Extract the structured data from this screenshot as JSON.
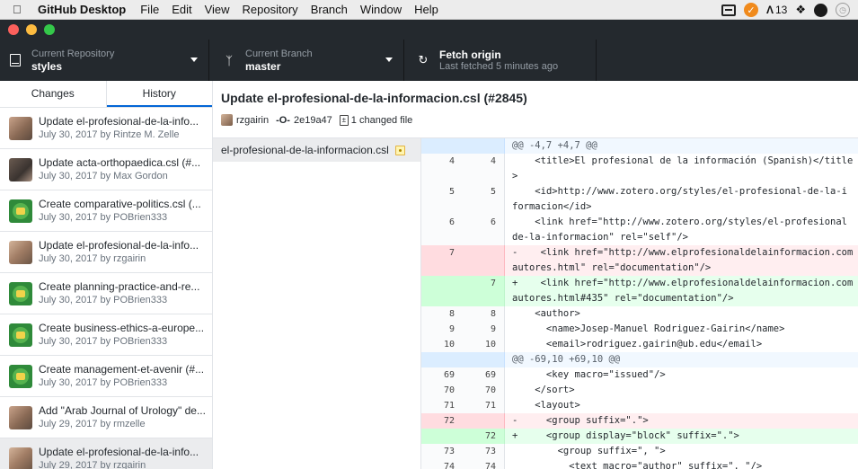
{
  "menubar": {
    "app": "GitHub Desktop",
    "items": [
      "File",
      "Edit",
      "View",
      "Repository",
      "Branch",
      "Window",
      "Help"
    ],
    "tray_adobe": "13"
  },
  "toolbar": {
    "repo_label": "Current Repository",
    "repo_value": "styles",
    "branch_label": "Current Branch",
    "branch_value": "master",
    "fetch_label": "Fetch origin",
    "fetch_status": "Last fetched 5 minutes ago"
  },
  "sidebar": {
    "tabs": [
      "Changes",
      "History"
    ],
    "commits": [
      {
        "title": "Update el-profesional-de-la-info...",
        "meta": "July 30, 2017 by Rintze M. Zelle"
      },
      {
        "title": "Update acta-orthopaedica.csl (#...",
        "meta": "July 30, 2017 by Max Gordon"
      },
      {
        "title": "Create comparative-politics.csl (...",
        "meta": "July 30, 2017 by POBrien333"
      },
      {
        "title": "Update el-profesional-de-la-info...",
        "meta": "July 30, 2017 by rzgairin"
      },
      {
        "title": "Create planning-practice-and-re...",
        "meta": "July 30, 2017 by POBrien333"
      },
      {
        "title": "Create business-ethics-a-europe...",
        "meta": "July 30, 2017 by POBrien333"
      },
      {
        "title": "Create management-et-avenir (#...",
        "meta": "July 30, 2017 by POBrien333"
      },
      {
        "title": "Add \"Arab Journal of Urology\" de...",
        "meta": "July 29, 2017 by rmzelle"
      },
      {
        "title": "Update el-profesional-de-la-info...",
        "meta": "July 29, 2017 by rzgairin"
      }
    ]
  },
  "commit": {
    "title": "Update el-profesional-de-la-informacion.csl (#2845)",
    "author": "rzgairin",
    "sha": "2e19a47",
    "files_changed": "1 changed file",
    "file": "el-profesional-de-la-informacion.csl"
  },
  "diff": [
    {
      "type": "hunk",
      "old": "",
      "new": "",
      "text": "@@ -4,7 +4,7 @@"
    },
    {
      "type": "ctx",
      "old": "4",
      "new": "4",
      "text": "    <title>El profesional de la información (Spanish)</title\n>"
    },
    {
      "type": "ctx",
      "old": "5",
      "new": "5",
      "text": "    <id>http://www.zotero.org/styles/el-profesional-de-la-i\nformacion</id>"
    },
    {
      "type": "ctx",
      "old": "6",
      "new": "6",
      "text": "    <link href=\"http://www.zotero.org/styles/el-profesional\nde-la-informacion\" rel=\"self\"/>"
    },
    {
      "type": "del",
      "old": "7",
      "new": "",
      "text": "-    <link href=\"http://www.elprofesionaldelainformacion.com\nautores.html\" rel=\"documentation\"/>"
    },
    {
      "type": "add",
      "old": "",
      "new": "7",
      "text": "+    <link href=\"http://www.elprofesionaldelainformacion.com\nautores.html#435\" rel=\"documentation\"/>"
    },
    {
      "type": "ctx",
      "old": "8",
      "new": "8",
      "text": "    <author>"
    },
    {
      "type": "ctx",
      "old": "9",
      "new": "9",
      "text": "      <name>Josep-Manuel Rodriguez-Gairin</name>"
    },
    {
      "type": "ctx",
      "old": "10",
      "new": "10",
      "text": "      <email>rodriguez.gairin@ub.edu</email>"
    },
    {
      "type": "hunk",
      "old": "",
      "new": "",
      "text": "@@ -69,10 +69,10 @@"
    },
    {
      "type": "ctx",
      "old": "69",
      "new": "69",
      "text": "      <key macro=\"issued\"/>"
    },
    {
      "type": "ctx",
      "old": "70",
      "new": "70",
      "text": "    </sort>"
    },
    {
      "type": "ctx",
      "old": "71",
      "new": "71",
      "text": "    <layout>"
    },
    {
      "type": "del",
      "old": "72",
      "new": "",
      "text": "-     <group suffix=\".\">"
    },
    {
      "type": "add",
      "old": "",
      "new": "72",
      "text": "+     <group display=\"block\" suffix=\".\">"
    },
    {
      "type": "ctx",
      "old": "73",
      "new": "73",
      "text": "        <group suffix=\", \">"
    },
    {
      "type": "ctx",
      "old": "74",
      "new": "74",
      "text": "          <text macro=\"author\" suffix=\". \"/>"
    }
  ]
}
